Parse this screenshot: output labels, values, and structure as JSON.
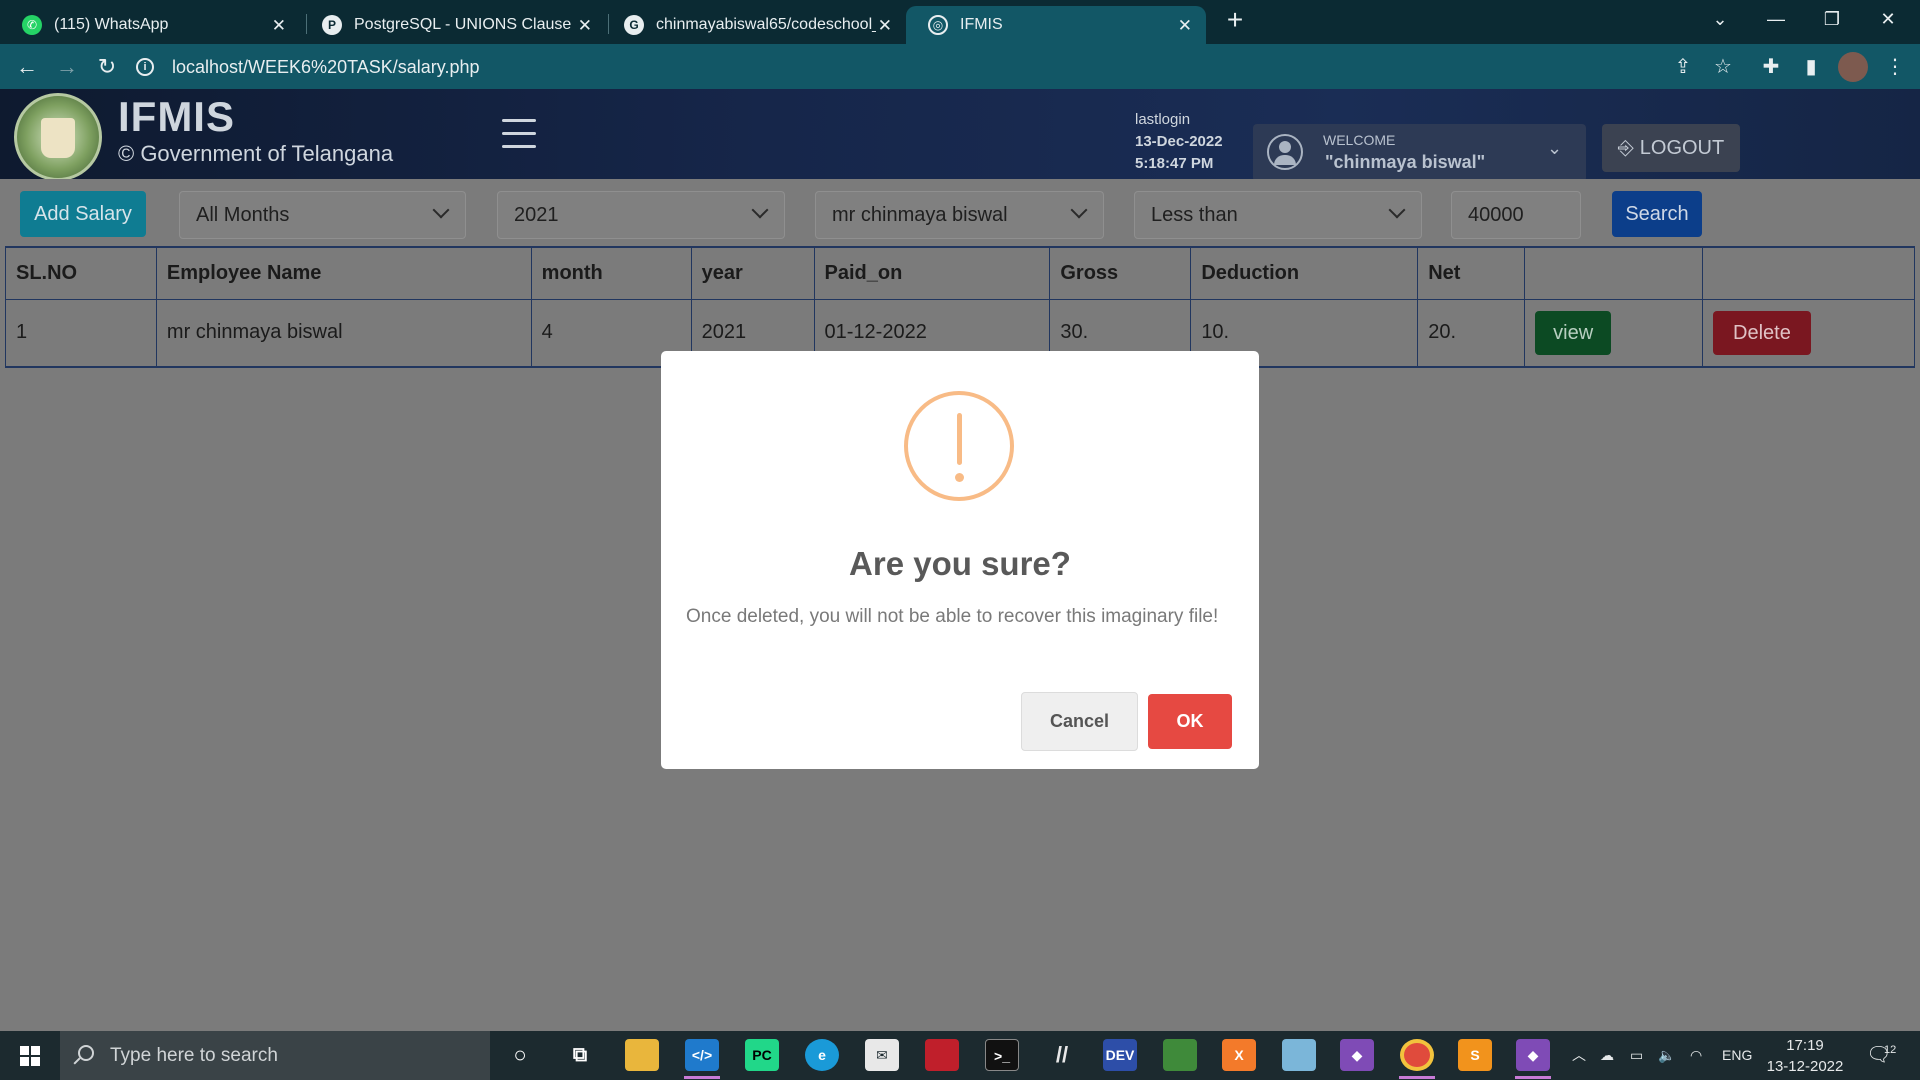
{
  "browser": {
    "tabs": [
      {
        "label": "(115) WhatsApp",
        "icon": "whatsapp-icon",
        "active": false
      },
      {
        "label": "PostgreSQL - UNIONS Clause",
        "icon": "postgresql-icon",
        "active": false
      },
      {
        "label": "chinmayabiswal65/codeschool_b",
        "icon": "github-icon",
        "active": false
      },
      {
        "label": "IFMIS",
        "icon": "globe-icon",
        "active": true
      }
    ],
    "url": "localhost/WEEK6%20TASK/salary.php"
  },
  "header": {
    "brand_title": "IFMIS",
    "brand_subtitle": "© Government of Telangana",
    "lastlogin_label": "lastlogin",
    "lastlogin_date": "13-Dec-2022",
    "lastlogin_time": "5:18:47 PM",
    "welcome_label": "WELCOME",
    "welcome_name": "\"chinmaya biswal\"",
    "logout_label": "LOGOUT"
  },
  "filters": {
    "add_label": "Add Salary",
    "month": "All Months",
    "year": "2021",
    "employee": "mr chinmaya biswal",
    "comparison": "Less than",
    "amount": "40000",
    "search_label": "Search"
  },
  "table": {
    "headers": [
      "SL.NO",
      "Employee Name",
      "month",
      "year",
      "Paid_on",
      "Gross",
      "Deduction",
      "Net"
    ],
    "rows": [
      {
        "slno": "1",
        "name": "mr chinmaya biswal",
        "month": "4",
        "year": "2021",
        "paid_on": "01-12-2022",
        "gross": "30.",
        "deduction": "10.",
        "net": "20.",
        "view_label": "view",
        "delete_label": "Delete"
      }
    ]
  },
  "modal": {
    "title": "Are you sure?",
    "text": "Once deleted, you will not be able to recover this imaginary file!",
    "cancel_label": "Cancel",
    "ok_label": "OK",
    "icon": "warning-icon",
    "icon_color": "#f8bb86",
    "ok_color": "#e64942"
  },
  "taskbar": {
    "search_placeholder": "Type here to search",
    "language": "ENG",
    "time": "17:19",
    "date": "13-12-2022",
    "notification_count": "12"
  }
}
